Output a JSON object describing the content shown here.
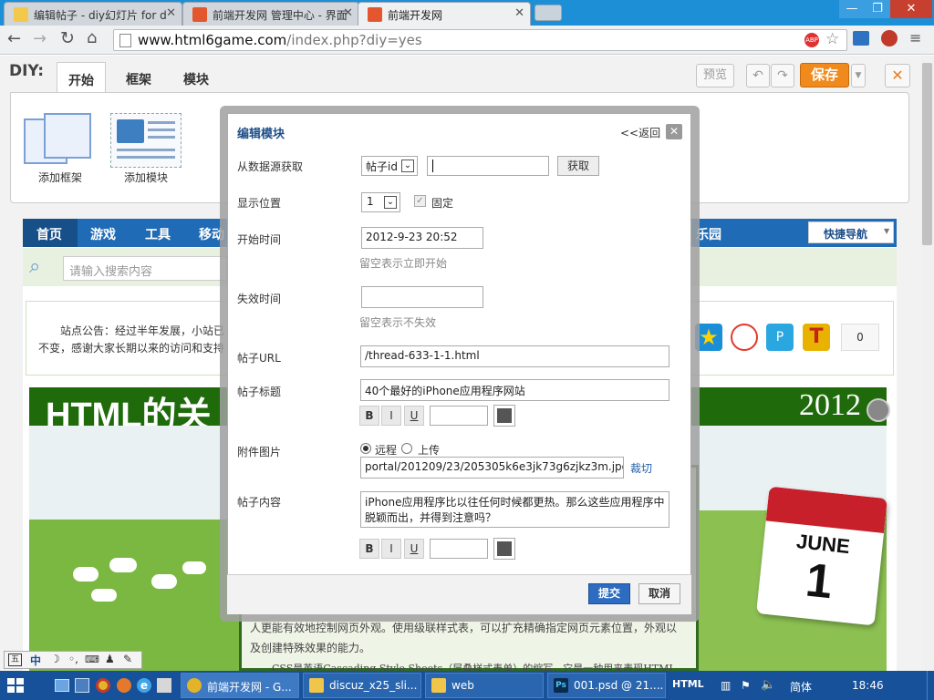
{
  "browser": {
    "tabs": [
      {
        "title": "编辑帖子 - diy幻灯片 for d",
        "active": false
      },
      {
        "title": "前端开发网 管理中心 - 界面",
        "active": false
      },
      {
        "title": "前端开发网",
        "active": true
      }
    ],
    "url_host": "www.html6game.com",
    "url_path": "/index.php?diy=yes"
  },
  "diy": {
    "label": "DIY:",
    "tabs": [
      "开始",
      "框架",
      "模块"
    ],
    "add_frame": "添加框架",
    "add_module": "添加模块",
    "preview": "预览",
    "save": "保存"
  },
  "page": {
    "nav": [
      "首页",
      "游戏",
      "工具",
      "移动",
      "乐园"
    ],
    "quick_nav": "快捷导航",
    "search_placeholder": "请输入搜索内容",
    "notice_line1": "站点公告：经过半年发展，小站已",
    "notice_line2": "不变，感谢大家长期以来的访问和支持",
    "counter": "0",
    "banner_title": "HTML的关",
    "banner_year": "2012",
    "calendar_month": "JUNE",
    "calendar_day": "1",
    "body_line1": "人更能有效地控制网页外观。使用级联样式表，可以扩充精确指定网页元素位置，外观以",
    "body_line2": "及创建特殊效果的能力。",
    "body_line3": "CSS是英语Cascading Style Sheets（层叠样式表单）的缩写，它是一种用来表现HTML"
  },
  "modal": {
    "title": "编辑模块",
    "back": "<<返回",
    "source_label": "从数据源获取",
    "source_select": "帖子id",
    "source_input": "",
    "fetch_button": "获取",
    "position_label": "显示位置",
    "position_value": "1",
    "fixed_label": "固定",
    "start_label": "开始时间",
    "start_value": "2012-9-23 20:52",
    "start_hint": "留空表示立即开始",
    "end_label": "失效时间",
    "end_value": "",
    "end_hint": "留空表示不失效",
    "url_label": "帖子URL",
    "url_value": "/thread-633-1-1.html",
    "title_label": "帖子标题",
    "title_value": "40个最好的iPhone应用程序网站",
    "attach_label": "附件图片",
    "radio_remote": "远程",
    "radio_upload": "上传",
    "attach_value": "portal/201209/23/205305k6e3jk73g6zjkz3m.jpg",
    "crop": "裁切",
    "content_label": "帖子内容",
    "content_value": "iPhone应用程序比以往任何时候都更热。那么这些应用程序中脱颖而出，并得到注意吗？",
    "bold": "B",
    "italic": "I",
    "underline": "U",
    "submit": "提交",
    "cancel": "取消"
  },
  "ime": {
    "label": "中"
  },
  "taskbar": {
    "tasks": [
      "前端开发网 - G...",
      "discuz_x25_sli...",
      "web",
      "001.psd @ 21....",
      "HTML"
    ],
    "lang": "简体",
    "clock": "18:46"
  },
  "colors": {
    "accent": "#1f6bb5",
    "save": "#f08a1c",
    "green": "#1f6b0b"
  }
}
